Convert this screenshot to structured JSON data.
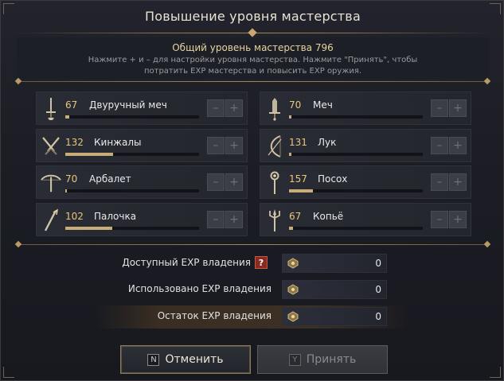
{
  "dialog": {
    "title": "Повышение уровня мастерства",
    "total_label": "Общий уровень мастерства 796",
    "hint_line1": "Нажмите + и – для настройки уровня мастерства. Нажмите \"Принять\", чтобы",
    "hint_line2": "потратить EXP мастерства и повысить EXP оружия."
  },
  "weapons": [
    {
      "level": "67",
      "name": "Двуручный меч",
      "progress": 0.03,
      "icon": "greatsword-icon"
    },
    {
      "level": "70",
      "name": "Меч",
      "progress": 0.02,
      "icon": "sword-icon"
    },
    {
      "level": "132",
      "name": "Кинжалы",
      "progress": 0.36,
      "icon": "daggers-icon"
    },
    {
      "level": "131",
      "name": "Лук",
      "progress": 0.02,
      "icon": "bow-icon"
    },
    {
      "level": "70",
      "name": "Арбалет",
      "progress": 0.0,
      "icon": "crossbow-icon"
    },
    {
      "level": "157",
      "name": "Посох",
      "progress": 0.18,
      "icon": "staff-icon"
    },
    {
      "level": "102",
      "name": "Палочка",
      "progress": 0.35,
      "icon": "wand-icon"
    },
    {
      "level": "67",
      "name": "Копьё",
      "progress": 0.03,
      "icon": "spear-icon"
    }
  ],
  "buttons": {
    "minus": "–",
    "plus": "+"
  },
  "exp": [
    {
      "label": "Доступный EXP владения",
      "value": "0",
      "help": "?"
    },
    {
      "label": "Использовано EXP владения",
      "value": "0"
    },
    {
      "label": "Остаток EXP владения",
      "value": "0"
    }
  ],
  "actions": {
    "cancel_key": "N",
    "cancel_label": "Отменить",
    "accept_key": "Y",
    "accept_label": "Принять"
  },
  "colors": {
    "accent": "#c9ad79",
    "level": "#e6c77a",
    "highlight_row": "#3c3024"
  }
}
